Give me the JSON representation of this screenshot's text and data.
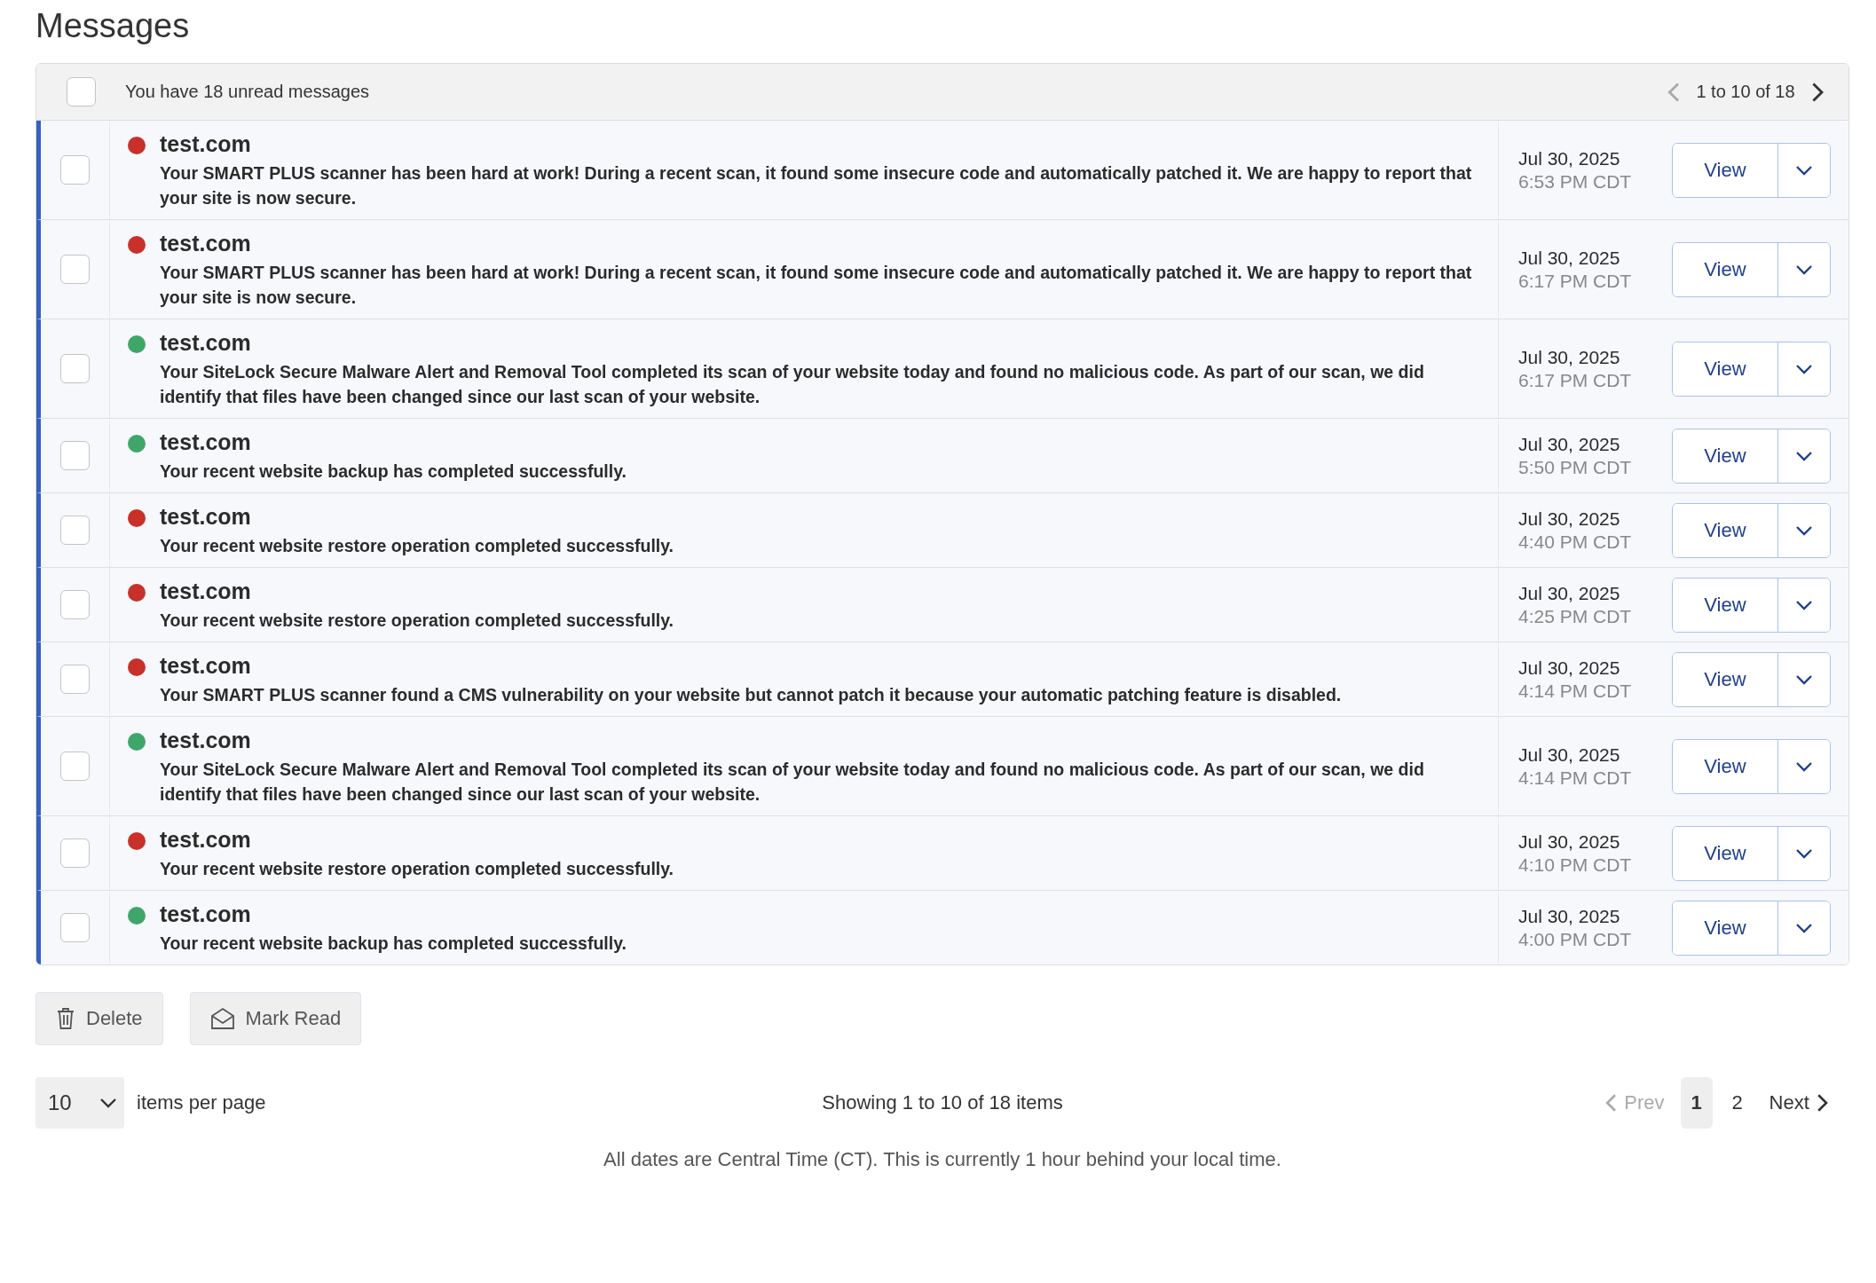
{
  "title": "Messages",
  "header": {
    "checked": false,
    "summary": "You have 18 unread messages",
    "range": "1 to 10 of 18",
    "prev_disabled": true,
    "next_disabled": false
  },
  "messages": [
    {
      "checked": false,
      "unread": true,
      "color": "#c8302a",
      "site": "test.com",
      "text": "Your SMART PLUS scanner has been hard at work! During a recent scan, it found some insecure code and automatically patched it. We are happy to report that your site is now secure.",
      "date": "Jul 30, 2025",
      "time": "6:53 PM CDT",
      "action": "View"
    },
    {
      "checked": false,
      "unread": true,
      "color": "#c8302a",
      "site": "test.com",
      "text": "Your SMART PLUS scanner has been hard at work! During a recent scan, it found some insecure code and automatically patched it. We are happy to report that your site is now secure.",
      "date": "Jul 30, 2025",
      "time": "6:17 PM CDT",
      "action": "View"
    },
    {
      "checked": false,
      "unread": true,
      "color": "#3fa66a",
      "site": "test.com",
      "text": "Your SiteLock Secure Malware Alert and Removal Tool completed its scan of your website today and found no malicious code. As part of our scan, we did identify that files have been changed since our last scan of your website.",
      "date": "Jul 30, 2025",
      "time": "6:17 PM CDT",
      "action": "View"
    },
    {
      "checked": false,
      "unread": true,
      "color": "#3fa66a",
      "site": "test.com",
      "text": "Your recent website backup has completed successfully.",
      "date": "Jul 30, 2025",
      "time": "5:50 PM CDT",
      "action": "View"
    },
    {
      "checked": false,
      "unread": true,
      "color": "#c8302a",
      "site": "test.com",
      "text": "Your recent website restore operation completed successfully.",
      "date": "Jul 30, 2025",
      "time": "4:40 PM CDT",
      "action": "View"
    },
    {
      "checked": false,
      "unread": true,
      "color": "#c8302a",
      "site": "test.com",
      "text": "Your recent website restore operation completed successfully.",
      "date": "Jul 30, 2025",
      "time": "4:25 PM CDT",
      "action": "View"
    },
    {
      "checked": false,
      "unread": true,
      "color": "#c8302a",
      "site": "test.com",
      "text": "Your SMART PLUS scanner found a CMS vulnerability on your website but cannot patch it because your automatic patching feature is disabled.",
      "date": "Jul 30, 2025",
      "time": "4:14 PM CDT",
      "action": "View"
    },
    {
      "checked": false,
      "unread": true,
      "color": "#3fa66a",
      "site": "test.com",
      "text": "Your SiteLock Secure Malware Alert and Removal Tool completed its scan of your website today and found no malicious code. As part of our scan, we did identify that files have been changed since our last scan of your website.",
      "date": "Jul 30, 2025",
      "time": "4:14 PM CDT",
      "action": "View"
    },
    {
      "checked": false,
      "unread": true,
      "color": "#c8302a",
      "site": "test.com",
      "text": "Your recent website restore operation completed successfully.",
      "date": "Jul 30, 2025",
      "time": "4:10 PM CDT",
      "action": "View"
    },
    {
      "checked": false,
      "unread": true,
      "color": "#3fa66a",
      "site": "test.com",
      "text": "Your recent website backup has completed successfully.",
      "date": "Jul 30, 2025",
      "time": "4:00 PM CDT",
      "action": "View"
    }
  ],
  "actions": [
    {
      "kind": "delete",
      "label": "Delete"
    },
    {
      "kind": "read",
      "label": "Mark Read"
    }
  ],
  "per_page": {
    "value": "10",
    "label": "items per page"
  },
  "showing": "Showing 1 to 10 of 18 items",
  "pagination": {
    "prev": "Prev",
    "prev_disabled": true,
    "pages": [
      {
        "label": "1",
        "selected": true
      },
      {
        "label": "2",
        "selected": false
      }
    ],
    "next": "Next"
  },
  "footnote": "All dates are Central Time (CT). This is currently 1 hour behind your local time."
}
